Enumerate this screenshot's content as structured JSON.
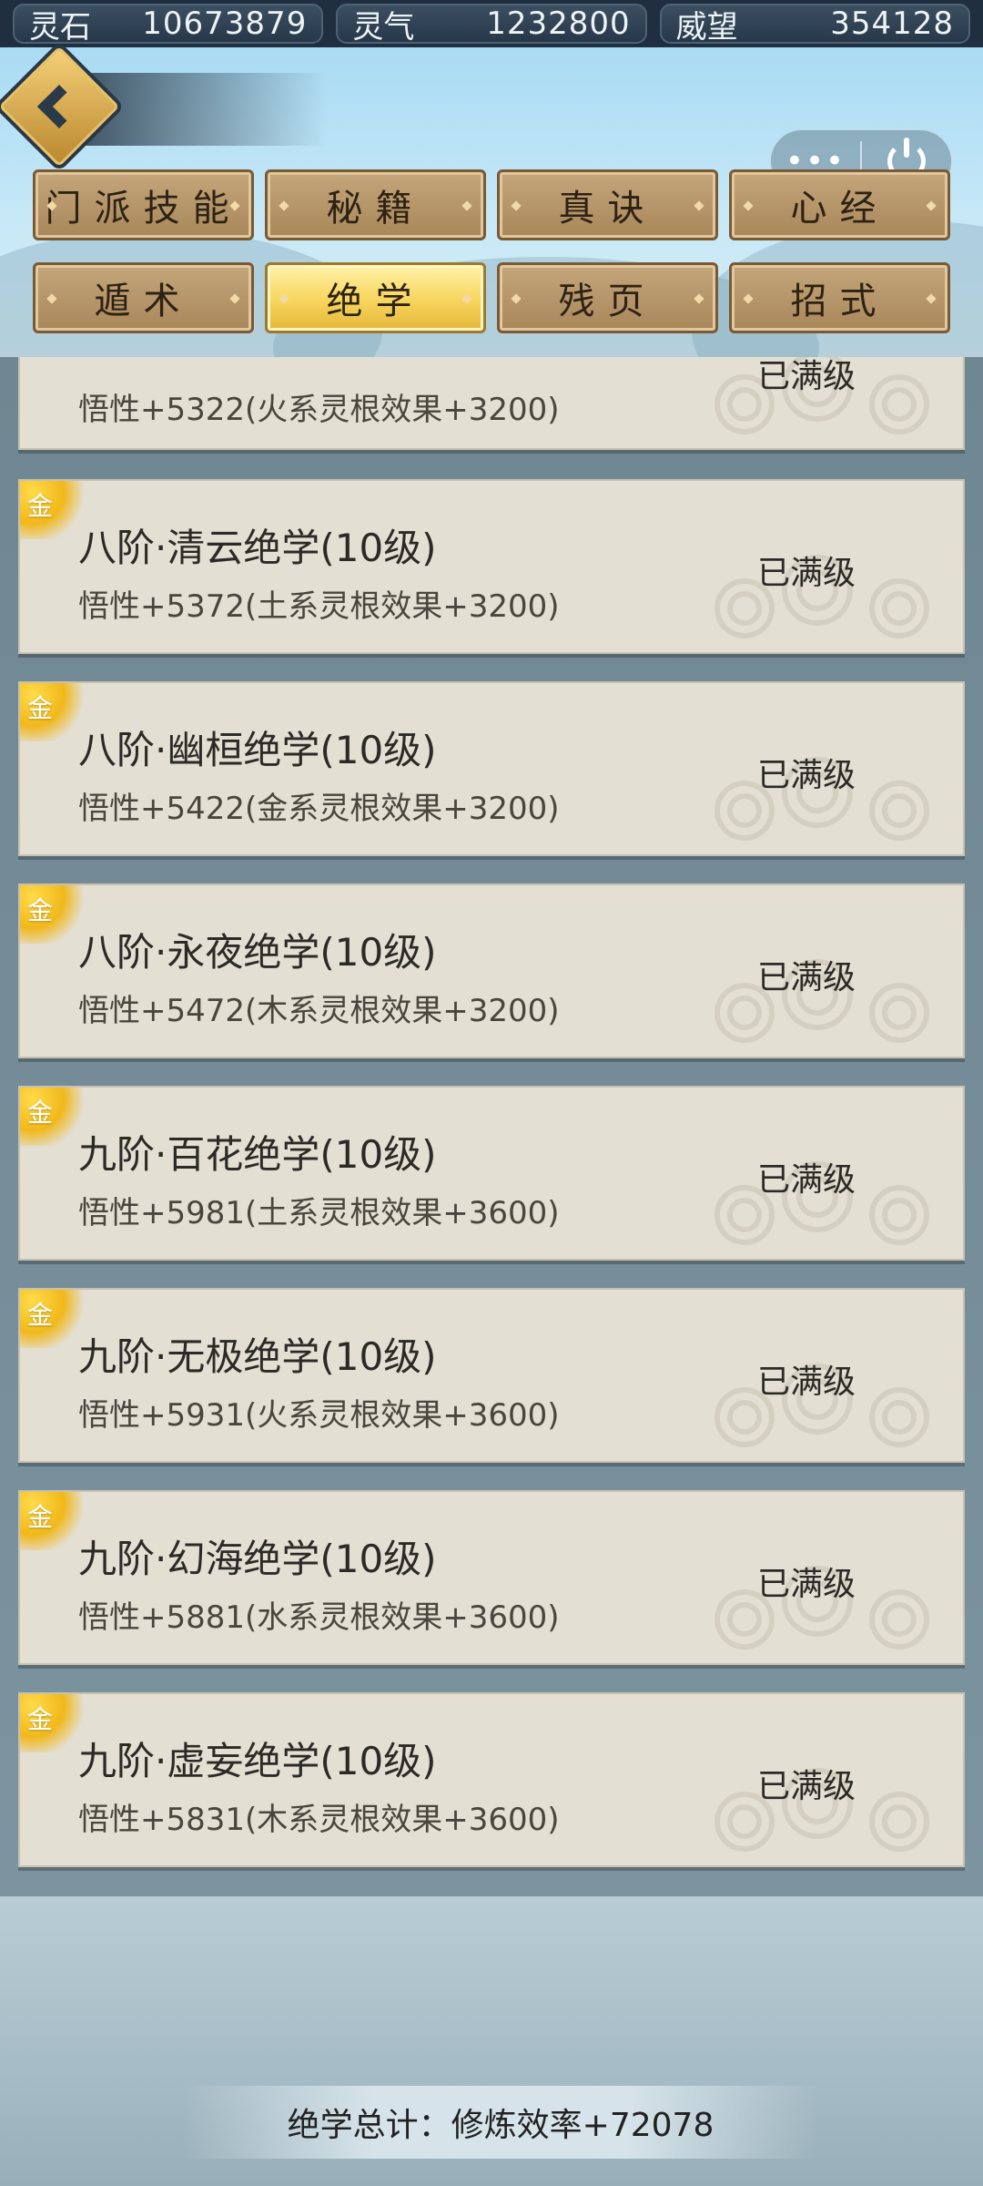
{
  "resources": [
    {
      "label": "灵石",
      "value": "10673879"
    },
    {
      "label": "灵气",
      "value": "1232800"
    },
    {
      "label": "威望",
      "value": "354128"
    }
  ],
  "capsule": {
    "more": "•••"
  },
  "tabs": [
    "门派技能",
    "秘籍",
    "真诀",
    "心经",
    "遁术",
    "绝学",
    "残页",
    "招式"
  ],
  "active_tab": "绝学",
  "partial_card": {
    "status": "已满级",
    "effect": "悟性+5322(火系灵根效果+3200)"
  },
  "cards": [
    {
      "badge": "金",
      "name": "八阶·清云绝学(10级)",
      "effect": "悟性+5372(土系灵根效果+3200)",
      "status": "已满级"
    },
    {
      "badge": "金",
      "name": "八阶·幽桓绝学(10级)",
      "effect": "悟性+5422(金系灵根效果+3200)",
      "status": "已满级"
    },
    {
      "badge": "金",
      "name": "八阶·永夜绝学(10级)",
      "effect": "悟性+5472(木系灵根效果+3200)",
      "status": "已满级"
    },
    {
      "badge": "金",
      "name": "九阶·百花绝学(10级)",
      "effect": "悟性+5981(土系灵根效果+3600)",
      "status": "已满级"
    },
    {
      "badge": "金",
      "name": "九阶·无极绝学(10级)",
      "effect": "悟性+5931(火系灵根效果+3600)",
      "status": "已满级"
    },
    {
      "badge": "金",
      "name": "九阶·幻海绝学(10级)",
      "effect": "悟性+5881(水系灵根效果+3600)",
      "status": "已满级"
    },
    {
      "badge": "金",
      "name": "九阶·虚妄绝学(10级)",
      "effect": "悟性+5831(木系灵根效果+3600)",
      "status": "已满级"
    }
  ],
  "total": "绝学总计：修炼效率+72078"
}
